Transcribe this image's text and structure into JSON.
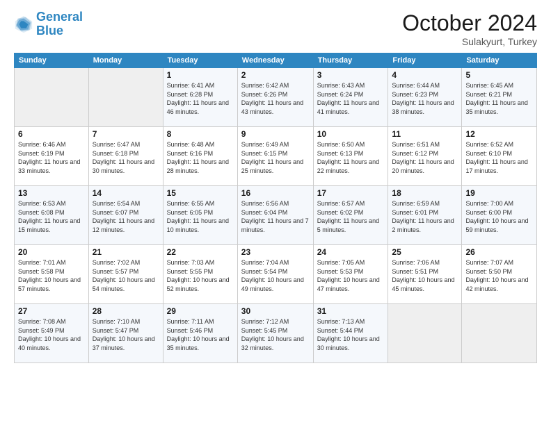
{
  "header": {
    "logo_line1": "General",
    "logo_line2": "Blue",
    "month": "October 2024",
    "location": "Sulakyurt, Turkey"
  },
  "weekdays": [
    "Sunday",
    "Monday",
    "Tuesday",
    "Wednesday",
    "Thursday",
    "Friday",
    "Saturday"
  ],
  "weeks": [
    [
      {
        "day": "",
        "info": ""
      },
      {
        "day": "",
        "info": ""
      },
      {
        "day": "1",
        "info": "Sunrise: 6:41 AM\nSunset: 6:28 PM\nDaylight: 11 hours and 46 minutes."
      },
      {
        "day": "2",
        "info": "Sunrise: 6:42 AM\nSunset: 6:26 PM\nDaylight: 11 hours and 43 minutes."
      },
      {
        "day": "3",
        "info": "Sunrise: 6:43 AM\nSunset: 6:24 PM\nDaylight: 11 hours and 41 minutes."
      },
      {
        "day": "4",
        "info": "Sunrise: 6:44 AM\nSunset: 6:23 PM\nDaylight: 11 hours and 38 minutes."
      },
      {
        "day": "5",
        "info": "Sunrise: 6:45 AM\nSunset: 6:21 PM\nDaylight: 11 hours and 35 minutes."
      }
    ],
    [
      {
        "day": "6",
        "info": "Sunrise: 6:46 AM\nSunset: 6:19 PM\nDaylight: 11 hours and 33 minutes."
      },
      {
        "day": "7",
        "info": "Sunrise: 6:47 AM\nSunset: 6:18 PM\nDaylight: 11 hours and 30 minutes."
      },
      {
        "day": "8",
        "info": "Sunrise: 6:48 AM\nSunset: 6:16 PM\nDaylight: 11 hours and 28 minutes."
      },
      {
        "day": "9",
        "info": "Sunrise: 6:49 AM\nSunset: 6:15 PM\nDaylight: 11 hours and 25 minutes."
      },
      {
        "day": "10",
        "info": "Sunrise: 6:50 AM\nSunset: 6:13 PM\nDaylight: 11 hours and 22 minutes."
      },
      {
        "day": "11",
        "info": "Sunrise: 6:51 AM\nSunset: 6:12 PM\nDaylight: 11 hours and 20 minutes."
      },
      {
        "day": "12",
        "info": "Sunrise: 6:52 AM\nSunset: 6:10 PM\nDaylight: 11 hours and 17 minutes."
      }
    ],
    [
      {
        "day": "13",
        "info": "Sunrise: 6:53 AM\nSunset: 6:08 PM\nDaylight: 11 hours and 15 minutes."
      },
      {
        "day": "14",
        "info": "Sunrise: 6:54 AM\nSunset: 6:07 PM\nDaylight: 11 hours and 12 minutes."
      },
      {
        "day": "15",
        "info": "Sunrise: 6:55 AM\nSunset: 6:05 PM\nDaylight: 11 hours and 10 minutes."
      },
      {
        "day": "16",
        "info": "Sunrise: 6:56 AM\nSunset: 6:04 PM\nDaylight: 11 hours and 7 minutes."
      },
      {
        "day": "17",
        "info": "Sunrise: 6:57 AM\nSunset: 6:02 PM\nDaylight: 11 hours and 5 minutes."
      },
      {
        "day": "18",
        "info": "Sunrise: 6:59 AM\nSunset: 6:01 PM\nDaylight: 11 hours and 2 minutes."
      },
      {
        "day": "19",
        "info": "Sunrise: 7:00 AM\nSunset: 6:00 PM\nDaylight: 10 hours and 59 minutes."
      }
    ],
    [
      {
        "day": "20",
        "info": "Sunrise: 7:01 AM\nSunset: 5:58 PM\nDaylight: 10 hours and 57 minutes."
      },
      {
        "day": "21",
        "info": "Sunrise: 7:02 AM\nSunset: 5:57 PM\nDaylight: 10 hours and 54 minutes."
      },
      {
        "day": "22",
        "info": "Sunrise: 7:03 AM\nSunset: 5:55 PM\nDaylight: 10 hours and 52 minutes."
      },
      {
        "day": "23",
        "info": "Sunrise: 7:04 AM\nSunset: 5:54 PM\nDaylight: 10 hours and 49 minutes."
      },
      {
        "day": "24",
        "info": "Sunrise: 7:05 AM\nSunset: 5:53 PM\nDaylight: 10 hours and 47 minutes."
      },
      {
        "day": "25",
        "info": "Sunrise: 7:06 AM\nSunset: 5:51 PM\nDaylight: 10 hours and 45 minutes."
      },
      {
        "day": "26",
        "info": "Sunrise: 7:07 AM\nSunset: 5:50 PM\nDaylight: 10 hours and 42 minutes."
      }
    ],
    [
      {
        "day": "27",
        "info": "Sunrise: 7:08 AM\nSunset: 5:49 PM\nDaylight: 10 hours and 40 minutes."
      },
      {
        "day": "28",
        "info": "Sunrise: 7:10 AM\nSunset: 5:47 PM\nDaylight: 10 hours and 37 minutes."
      },
      {
        "day": "29",
        "info": "Sunrise: 7:11 AM\nSunset: 5:46 PM\nDaylight: 10 hours and 35 minutes."
      },
      {
        "day": "30",
        "info": "Sunrise: 7:12 AM\nSunset: 5:45 PM\nDaylight: 10 hours and 32 minutes."
      },
      {
        "day": "31",
        "info": "Sunrise: 7:13 AM\nSunset: 5:44 PM\nDaylight: 10 hours and 30 minutes."
      },
      {
        "day": "",
        "info": ""
      },
      {
        "day": "",
        "info": ""
      }
    ]
  ]
}
